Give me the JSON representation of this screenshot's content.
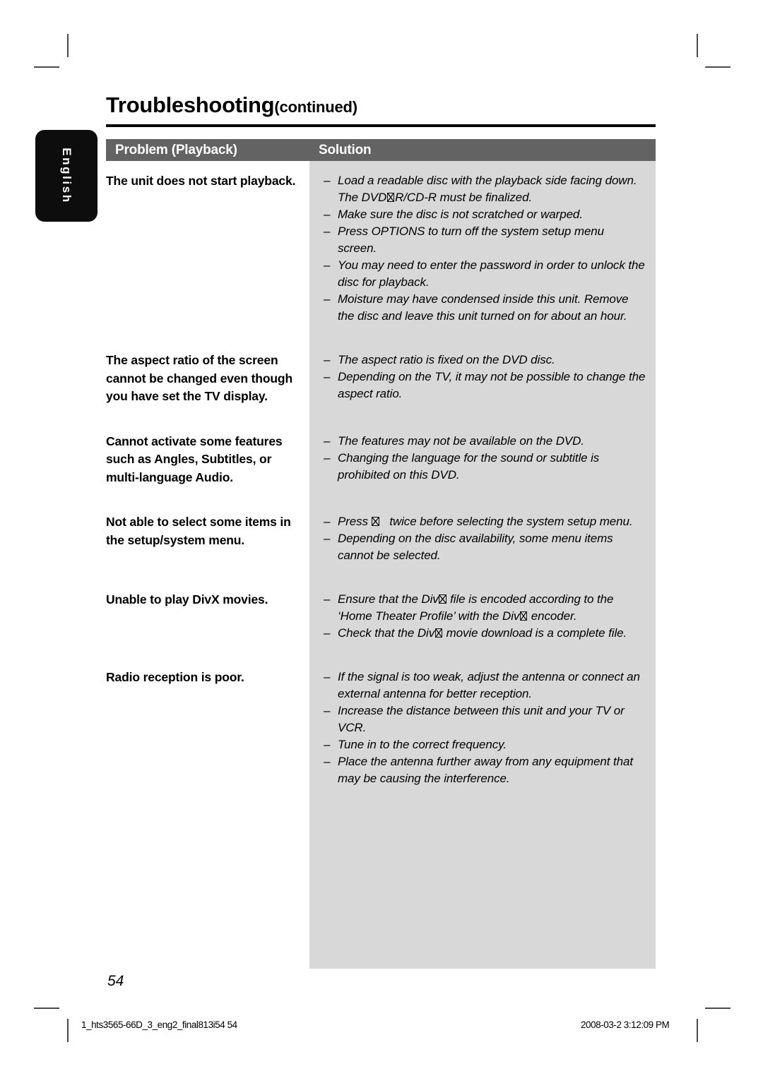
{
  "page": {
    "title_main": "Troubleshooting",
    "title_continued": "(continued)",
    "number": "54",
    "language_tab": "English"
  },
  "table": {
    "header": {
      "problem": "Problem (Playback)",
      "solution": "Solution"
    },
    "rows": [
      {
        "problem": "The unit does not start playback.",
        "solutions": [
          "Load a readable disc with the playback side facing down. The DVD±R/CD-R must be finalized.",
          "Make sure the disc is not scratched or warped.",
          "Press OPTIONS to turn off the system setup menu screen.",
          "You may need to enter the password in order to unlock the disc for playback.",
          "Moisture may have condensed inside this unit. Remove the disc and leave this unit turned on for about an hour."
        ]
      },
      {
        "problem": "The aspect ratio of the screen cannot be changed even though you have set the TV display.",
        "solutions": [
          "The aspect ratio is fixed on the DVD disc.",
          "Depending on the TV, it may not be possible to change the aspect ratio."
        ]
      },
      {
        "problem": "Cannot activate some features such as Angles, Subtitles, or multi-language Audio.",
        "solutions": [
          "The features may not be available on the DVD.",
          "Changing the language for the sound or subtitle is prohibited on this DVD."
        ]
      },
      {
        "problem": "Not able to select some items in the setup/system menu.",
        "solutions": [
          "Press ■ twice before selecting the system setup menu.",
          "Depending on the disc availability, some menu items cannot be selected."
        ]
      },
      {
        "problem": "Unable to play DivX movies.",
        "solutions": [
          "Ensure that the DivX file is encoded according to the ‘Home Theater Profile’ with the DivX encoder.",
          "Check that the DivX movie download is a complete file."
        ]
      },
      {
        "problem": "Radio reception is poor.",
        "solutions": [
          "If the signal is too weak, adjust the antenna or connect an external antenna for better reception.",
          "Increase the distance between this unit and your TV or VCR.",
          "Tune in to the correct frequency.",
          "Place the antenna further away from any equipment that may be causing the interference."
        ]
      }
    ]
  },
  "footer": {
    "file_reference": "1_hts3565-66D_3_eng2_final813i54   54",
    "timestamp": "2008-03-2   3:12:09 PM"
  },
  "colors": {
    "header_bar": "#636363",
    "solution_column": "#d8d8d8",
    "tab_background": "#0d0d0d"
  }
}
